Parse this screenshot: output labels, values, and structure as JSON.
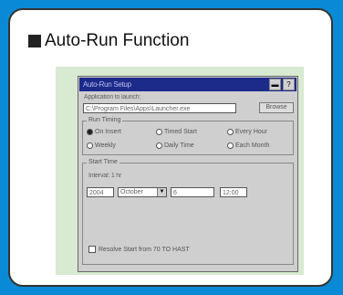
{
  "heading": {
    "title": "Auto-Run Function"
  },
  "dialog": {
    "title": "Auto-Run Setup",
    "controls": {
      "minimize": "▬",
      "help": "?"
    },
    "file_label": "Application to launch:",
    "file_value": "C:\\Program Files\\Apps\\Launcher.exe",
    "browse_label": "Browse",
    "run_group_title": "Run Timing",
    "run_options": [
      {
        "label": "On Insert",
        "selected": true
      },
      {
        "label": "Timed Start",
        "selected": false
      },
      {
        "label": "Every Hour",
        "selected": false
      },
      {
        "label": "Weekly",
        "selected": false
      },
      {
        "label": "Daily Time",
        "selected": false
      },
      {
        "label": "Each Month",
        "selected": false
      }
    ],
    "start_group_title": "Start Time",
    "interval_label": "Interval: 1 hr",
    "date_fields": [
      "2004",
      "October",
      "6",
      "12:00"
    ],
    "checkbox_label": "Resolve Start from 70 TO HAST"
  }
}
